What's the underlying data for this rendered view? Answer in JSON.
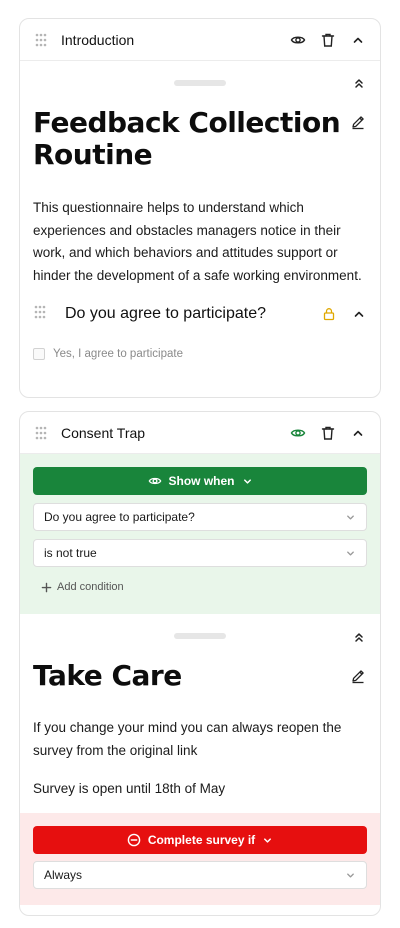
{
  "intro_card": {
    "header_title": "Introduction",
    "title": "Feedback Collection Routine",
    "description": "This questionnaire helps to understand which experiences and obstacles managers notice in their work, and which behaviors and attitudes support or hinder the development of a safe working environment.",
    "question": {
      "label": "Do you agree to participate?",
      "option_label": "Yes, I agree to participate"
    }
  },
  "consent_card": {
    "header_title": "Consent Trap",
    "show_when": {
      "button_label": "Show when",
      "question_select": "Do you agree to participate?",
      "condition_select": "is not true",
      "add_condition_label": "Add condition"
    },
    "title": "Take Care",
    "paragraph_1": "If you change your mind you can always reopen the survey from the original link",
    "paragraph_2": "Survey is open until 18th of May",
    "complete_if": {
      "button_label": "Complete survey if",
      "select_value": "Always"
    }
  },
  "colors": {
    "show_when_green": "#19853b",
    "complete_red": "#e60f0f",
    "lock_amber": "#e0a800",
    "visible_eye_green": "#19853b"
  }
}
